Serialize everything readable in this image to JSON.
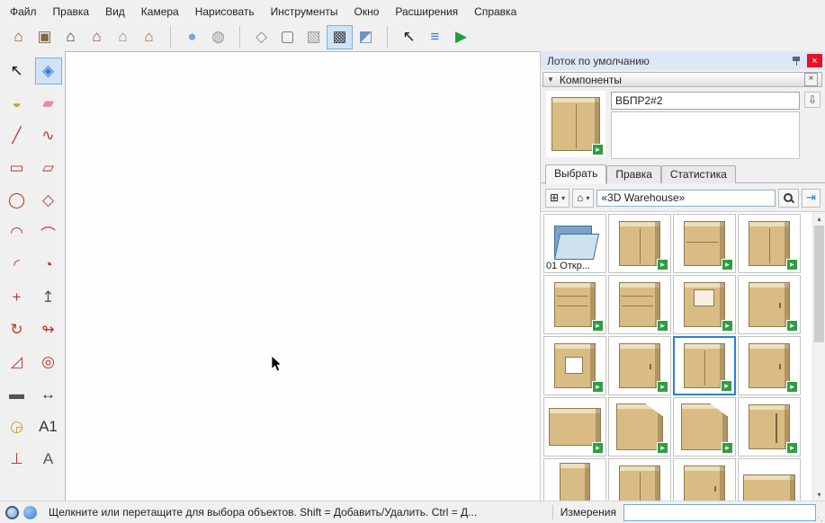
{
  "colors": {
    "accent_blue": "#2a7fd4",
    "selection_bg": "#cfe4f7",
    "badge_green": "#2f9e41",
    "cabinet_tan": "#d8bc83",
    "close_red": "#e81123"
  },
  "icons": {
    "expander": "▼",
    "close": "×",
    "dropdown": "▾",
    "scroll_up": "▴",
    "scroll_down": "▾",
    "home": "⌂",
    "grid_view": "⊞",
    "secondary_pane": "⇩",
    "advanced": "⇥",
    "grip": "⋱",
    "badge_arrow": "▸"
  },
  "menu": {
    "items": [
      {
        "name": "file",
        "label": "Файл"
      },
      {
        "name": "edit",
        "label": "Правка"
      },
      {
        "name": "view",
        "label": "Вид"
      },
      {
        "name": "camera",
        "label": "Камера"
      },
      {
        "name": "draw",
        "label": "Нарисовать"
      },
      {
        "name": "tools",
        "label": "Инструменты"
      },
      {
        "name": "window",
        "label": "Окно"
      },
      {
        "name": "extensions",
        "label": "Расширения"
      },
      {
        "name": "help",
        "label": "Справка"
      }
    ]
  },
  "toolbar": {
    "groups": [
      {
        "name": "cabinet-extension-group",
        "icons": [
          {
            "name": "roof-tool-icon",
            "glyph": "⌂",
            "color": "#8a5a2a"
          },
          {
            "name": "cabinet-stack-icon",
            "glyph": "▣",
            "color": "#7d6a4e"
          },
          {
            "name": "base-cabinet-icon",
            "glyph": "⌂",
            "color": "#3a3a3a"
          },
          {
            "name": "sink-cabinet-icon",
            "glyph": "⌂",
            "color": "#9b3b2e"
          },
          {
            "name": "wall-cabinet-icon",
            "glyph": "⌂",
            "color": "#8c8c8c"
          },
          {
            "name": "roof-frame-icon",
            "glyph": "⌂",
            "color": "#a0622d"
          }
        ]
      },
      {
        "name": "view-style-group",
        "icons": [
          {
            "name": "shaded-sphere-icon",
            "glyph": "●",
            "color": "#7aa7d6"
          },
          {
            "name": "wireframe-sphere-icon",
            "glyph": "◍",
            "color": "#9a9a9a"
          },
          {
            "name": "sep"
          },
          {
            "name": "xray-box-icon",
            "glyph": "◇",
            "color": "#7f8fa0"
          },
          {
            "name": "wireframe-box-icon",
            "glyph": "▢",
            "color": "#707070"
          },
          {
            "name": "hidden-line-box-icon",
            "glyph": "▧",
            "color": "#9a9a9a"
          },
          {
            "name": "shaded-textures-box-icon",
            "glyph": "▩",
            "color": "#4a4a4a",
            "selected": true
          },
          {
            "name": "monochrome-box-icon",
            "glyph": "◩",
            "color": "#6f93c2"
          }
        ]
      },
      {
        "name": "utility-group",
        "icons": [
          {
            "name": "select-cursor-icon",
            "glyph": "↖",
            "color": "#1a1a1a"
          },
          {
            "name": "entity-info-icon",
            "glyph": "≡",
            "color": "#3a7bd5"
          },
          {
            "name": "run-extension-icon",
            "glyph": "▶",
            "color": "#1f9e3e"
          }
        ]
      }
    ]
  },
  "tools": {
    "rows": [
      [
        {
          "name": "select-tool",
          "glyph": "↖",
          "color": "#111"
        },
        {
          "name": "make-component-tool",
          "glyph": "◈",
          "color": "#3a7bd5",
          "selected": true
        }
      ],
      [
        {
          "name": "paint-bucket-tool",
          "glyph": "◒",
          "color": "#c9a227"
        },
        {
          "name": "eraser-tool",
          "glyph": "▰",
          "color": "#e98a9a"
        }
      ],
      [
        {
          "name": "line-tool",
          "glyph": "╱",
          "color": "#c0392b"
        },
        {
          "name": "freehand-tool",
          "glyph": "∿",
          "color": "#c0392b"
        }
      ],
      [
        {
          "name": "rectangle-tool",
          "glyph": "▭",
          "color": "#c0392b"
        },
        {
          "name": "rotated-rectangle-tool",
          "glyph": "▱",
          "color": "#c0392b"
        }
      ],
      [
        {
          "name": "circle-tool",
          "glyph": "◯",
          "color": "#c0392b"
        },
        {
          "name": "polygon-tool",
          "glyph": "◇",
          "color": "#c0392b"
        }
      ],
      [
        {
          "name": "arc-tool",
          "glyph": "◠",
          "color": "#c0392b"
        },
        {
          "name": "two-point-arc-tool",
          "glyph": "⌒",
          "color": "#c0392b"
        }
      ],
      [
        {
          "name": "three-point-arc-tool",
          "glyph": "◜",
          "color": "#c0392b"
        },
        {
          "name": "pie-tool",
          "glyph": "◔",
          "color": "#c0392b"
        }
      ],
      [
        {
          "name": "move-tool",
          "glyph": "+",
          "color": "#c0392b"
        },
        {
          "name": "push-pull-tool",
          "glyph": "↥",
          "color": "#555"
        }
      ],
      [
        {
          "name": "rotate-tool",
          "glyph": "↻",
          "color": "#c0392b"
        },
        {
          "name": "follow-me-tool",
          "glyph": "↬",
          "color": "#c0392b"
        }
      ],
      [
        {
          "name": "scale-tool",
          "glyph": "◿",
          "color": "#c0392b"
        },
        {
          "name": "offset-tool",
          "glyph": "◎",
          "color": "#c0392b"
        }
      ],
      [
        {
          "name": "tape-measure-tool",
          "glyph": "▬",
          "color": "#555"
        },
        {
          "name": "dimension-tool",
          "glyph": "↔",
          "color": "#333"
        }
      ],
      [
        {
          "name": "protractor-tool",
          "glyph": "◶",
          "color": "#c9a227"
        },
        {
          "name": "text-tool",
          "glyph": "A1",
          "color": "#333"
        }
      ],
      [
        {
          "name": "axes-tool",
          "glyph": "⊥",
          "color": "#c0392b"
        },
        {
          "name": "3d-text-tool",
          "glyph": "A",
          "color": "#555"
        }
      ]
    ]
  },
  "tray": {
    "title": "Лоток по умолчанию",
    "components": {
      "section_title": "Компоненты",
      "name_value": "ВБПР2#2",
      "tabs": [
        {
          "name": "select",
          "label": "Выбрать",
          "active": true
        },
        {
          "name": "edit",
          "label": "Правка",
          "active": false
        },
        {
          "name": "statistics",
          "label": "Статистика",
          "active": false
        }
      ],
      "search_text": "«3D Warehouse»",
      "grid": {
        "items": [
          {
            "variant": "folder",
            "label": "01 Откр...",
            "badge": false
          },
          {
            "variant": "door2",
            "badge": true
          },
          {
            "variant": "drawers2",
            "badge": true
          },
          {
            "variant": "door2",
            "badge": true
          },
          {
            "variant": "drawers3",
            "badge": true
          },
          {
            "variant": "drawers3",
            "badge": true
          },
          {
            "variant": "niche",
            "badge": true
          },
          {
            "variant": "door1",
            "badge": true
          },
          {
            "variant": "window",
            "badge": true
          },
          {
            "variant": "door1",
            "badge": true
          },
          {
            "variant": "door2",
            "badge": true,
            "selected": true
          },
          {
            "variant": "door1",
            "badge": true
          },
          {
            "variant": "wide",
            "badge": true
          },
          {
            "variant": "corner",
            "badge": true
          },
          {
            "variant": "corner",
            "badge": true
          },
          {
            "variant": "handle",
            "badge": true
          },
          {
            "variant": "tall",
            "badge": false
          },
          {
            "variant": "door2",
            "badge": false
          },
          {
            "variant": "door1",
            "badge": true
          },
          {
            "variant": "low",
            "badge": false
          }
        ]
      }
    }
  },
  "status": {
    "hint": "Щелкните или перетащите для выбора объектов. Shift = Добавить/Удалить. Ctrl = Д...",
    "measure_label": "Измерения",
    "measure_value": ""
  }
}
